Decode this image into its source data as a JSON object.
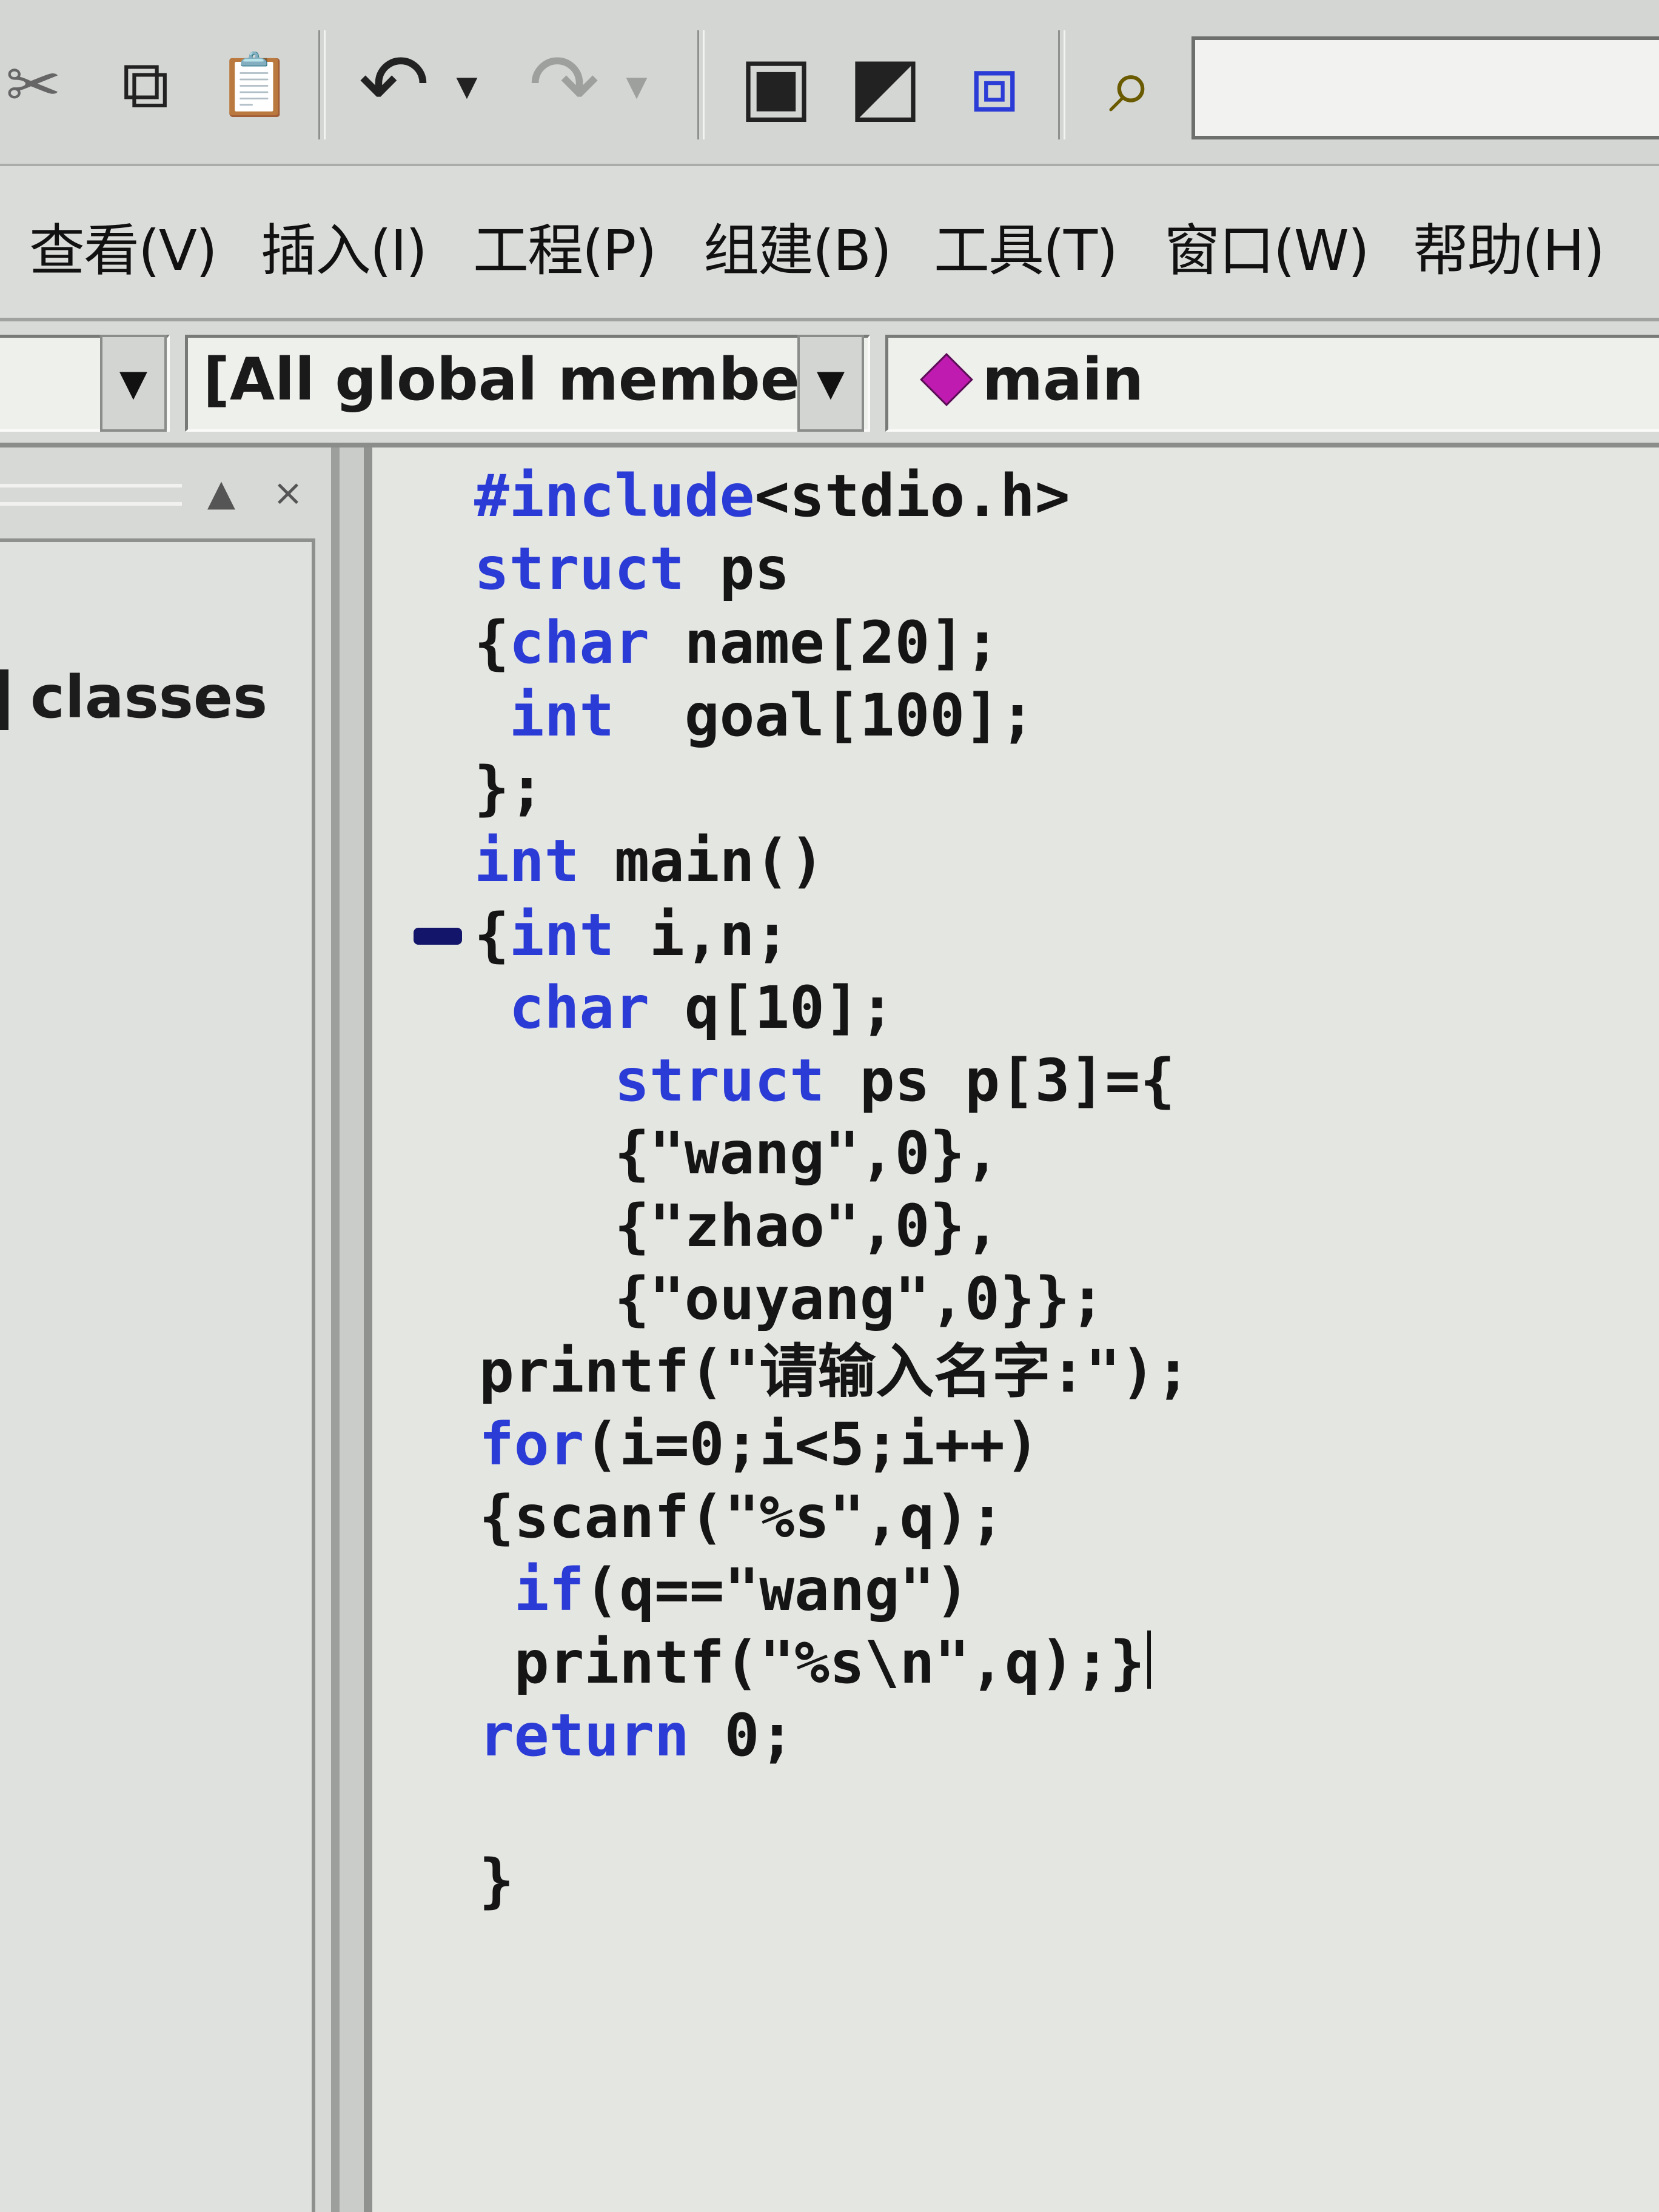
{
  "toolbar": {
    "buttons": [
      {
        "name": "cut",
        "icon": "✂"
      },
      {
        "name": "copy",
        "icon": "⧉"
      },
      {
        "name": "paste",
        "icon": "📋"
      },
      {
        "name": "undo",
        "icon": "↶"
      },
      {
        "name": "undo-dropdown",
        "icon": "▾"
      },
      {
        "name": "redo",
        "icon": "↷"
      },
      {
        "name": "redo-dropdown",
        "icon": "▾"
      },
      {
        "name": "workspace",
        "icon": "▣"
      },
      {
        "name": "output",
        "icon": "◩"
      },
      {
        "name": "window-list",
        "icon": "⧈"
      },
      {
        "name": "find-in-files",
        "icon": "⌕"
      }
    ]
  },
  "menubar": {
    "items": [
      "查看(V)",
      "插入(I)",
      "工程(P)",
      "组建(B)",
      "工具(T)",
      "窗口(W)",
      "帮助(H)"
    ]
  },
  "wizardbar": {
    "members_filter": "[All global members",
    "function": "main",
    "function_icon": "diamond-icon",
    "dropdown_glyph": "▼"
  },
  "workspace": {
    "tab_label": "classes",
    "close_glyph": "×",
    "dock_glyph": "▲"
  },
  "editor": {
    "lines": [
      [
        {
          "t": "#include",
          "k": 1
        },
        {
          "t": "<stdio.h>",
          "k": 0
        }
      ],
      [
        {
          "t": "struct",
          "k": 1
        },
        {
          "t": " ps",
          "k": 0
        }
      ],
      [
        {
          "t": "{",
          "k": 0
        },
        {
          "t": "char",
          "k": 1
        },
        {
          "t": " name[20];",
          "k": 0
        }
      ],
      [
        {
          "t": " ",
          "k": 0
        },
        {
          "t": "int",
          "k": 1
        },
        {
          "t": "  goal[100];",
          "k": 0
        }
      ],
      [
        {
          "t": "};",
          "k": 0
        }
      ],
      [
        {
          "t": "int",
          "k": 1
        },
        {
          "t": " main()",
          "k": 0
        }
      ],
      [
        {
          "t": "{",
          "k": 0
        },
        {
          "t": "int",
          "k": 1
        },
        {
          "t": " i,n;",
          "k": 0
        }
      ],
      [
        {
          "t": " ",
          "k": 0
        },
        {
          "t": "char",
          "k": 1
        },
        {
          "t": " q[10];",
          "k": 0
        }
      ],
      [
        {
          "t": "    ",
          "k": 0
        },
        {
          "t": "struct",
          "k": 1
        },
        {
          "t": " ps p[3]={",
          "k": 0
        }
      ],
      [
        {
          "t": "    {\"wang\",0},",
          "k": 0
        }
      ],
      [
        {
          "t": "    {\"zhao\",0},",
          "k": 0
        }
      ],
      [
        {
          "t": "    {\"ouyang\",0}};",
          "k": 0
        }
      ],
      [
        {
          "t": "printf(\"请输入名字:\");",
          "k": 0
        }
      ],
      [
        {
          "t": "for",
          "k": 1
        },
        {
          "t": "(i=0;i<5;i++)",
          "k": 0
        }
      ],
      [
        {
          "t": "{scanf(\"%s\",q);",
          "k": 0
        }
      ],
      [
        {
          "t": " ",
          "k": 0
        },
        {
          "t": "if",
          "k": 1
        },
        {
          "t": "(q==\"wang\")",
          "k": 0
        }
      ],
      [
        {
          "t": " printf(\"%s\\n\",q);}",
          "k": 0
        }
      ],
      [
        {
          "t": "return",
          "k": 1
        },
        {
          "t": " 0;",
          "k": 0
        }
      ],
      [
        {
          "t": "",
          "k": 0
        }
      ],
      [
        {
          "t": "}",
          "k": 0
        }
      ]
    ],
    "breakpoint_line": 7,
    "cursor_line": 17,
    "keyword_color": "#2b3bd6"
  }
}
